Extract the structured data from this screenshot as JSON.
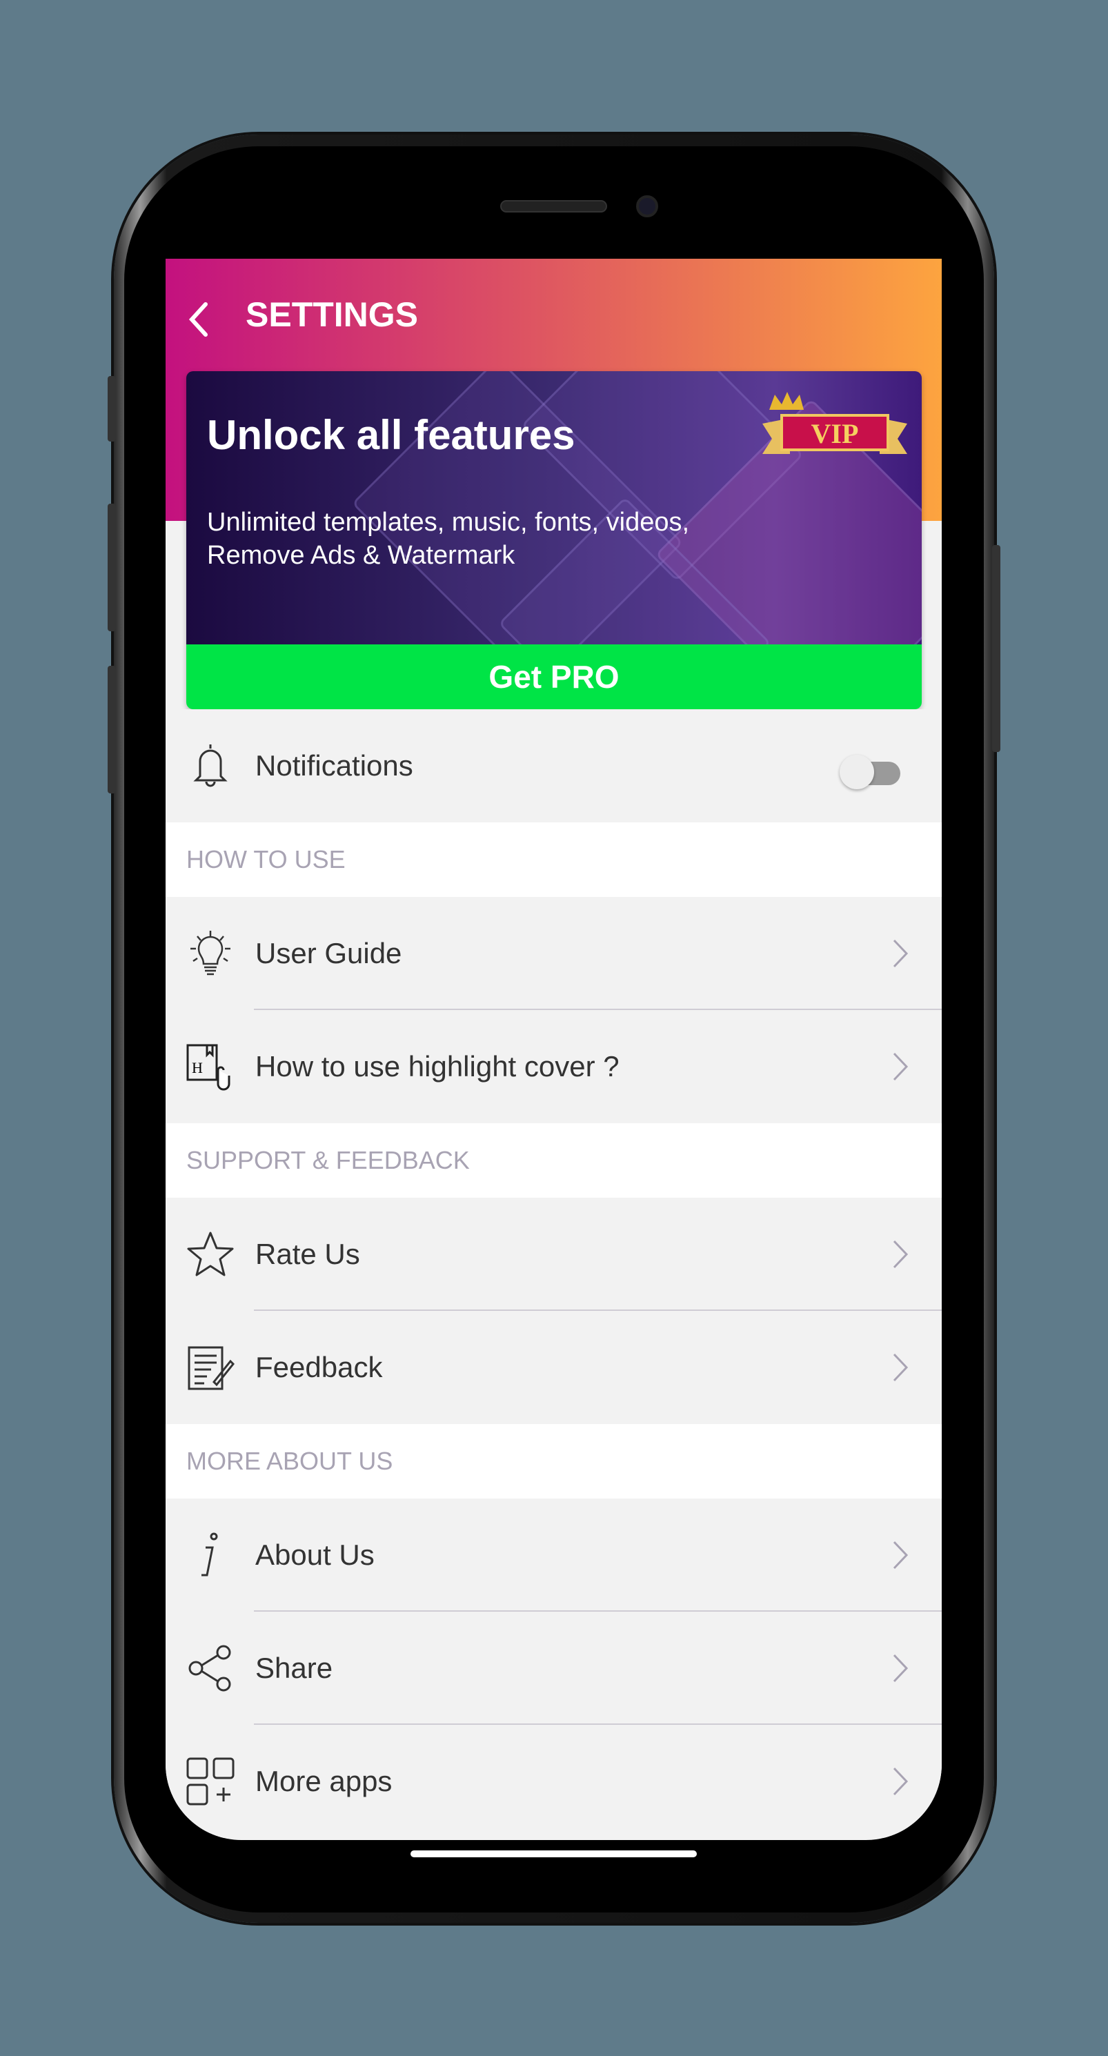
{
  "header": {
    "title": "SETTINGS",
    "back_icon": "chevron-left-icon",
    "gradient": [
      "#c3117f",
      "#fda43f"
    ]
  },
  "promo": {
    "title": "Unlock all features",
    "subtitle_line1": "Unlimited templates, music, fonts, videos,",
    "subtitle_line2": "Remove Ads & Watermark",
    "badge": "VIP",
    "cta": "Get PRO",
    "cta_color": "#00e446"
  },
  "notifications": {
    "label": "Notifications",
    "icon": "bell-icon",
    "enabled": false
  },
  "sections": [
    {
      "title": "HOW TO USE",
      "items": [
        {
          "label": "User Guide",
          "icon": "lightbulb-icon"
        },
        {
          "label": "How to use highlight cover ?",
          "icon": "highlight-cover-icon"
        }
      ]
    },
    {
      "title": "SUPPORT & FEEDBACK",
      "items": [
        {
          "label": "Rate Us",
          "icon": "star-icon"
        },
        {
          "label": "Feedback",
          "icon": "feedback-icon"
        }
      ]
    },
    {
      "title": "MORE ABOUT US",
      "items": [
        {
          "label": "About Us",
          "icon": "info-icon"
        },
        {
          "label": "Share",
          "icon": "share-icon"
        },
        {
          "label": "More apps",
          "icon": "more-apps-icon"
        }
      ]
    }
  ]
}
